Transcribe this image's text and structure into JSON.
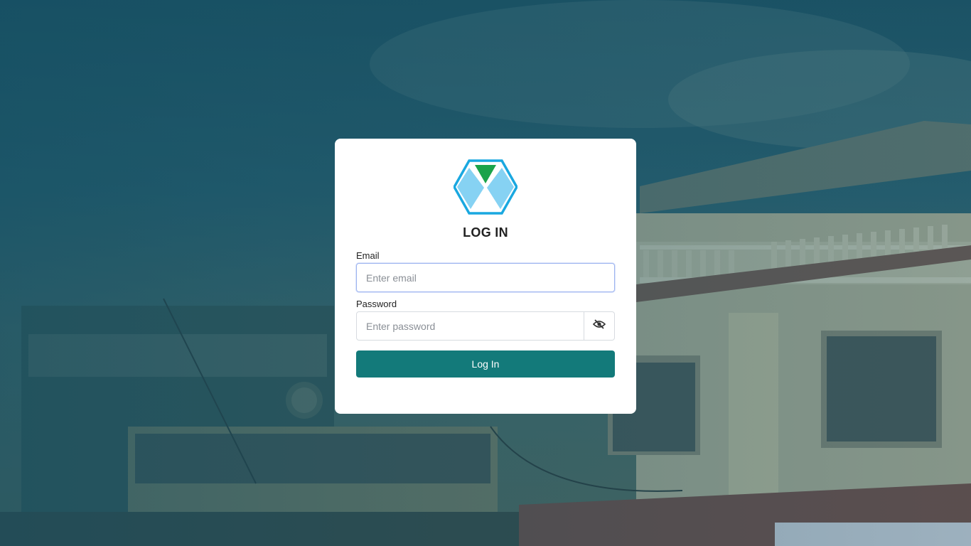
{
  "login": {
    "title": "LOG IN",
    "email_label": "Email",
    "email_placeholder": "Enter email",
    "password_label": "Password",
    "password_placeholder": "Enter password",
    "toggle_icon": "eye-slash-icon",
    "submit_label": "Log In"
  },
  "logo": {
    "icon": "hexagon-logo-icon",
    "colors": {
      "outline": "#1aa8e0",
      "fill": "#86d2f3",
      "accent": "#1aa34a"
    }
  },
  "theme": {
    "primary_button": "#137a7a",
    "overlay_tint": "#124e62"
  }
}
